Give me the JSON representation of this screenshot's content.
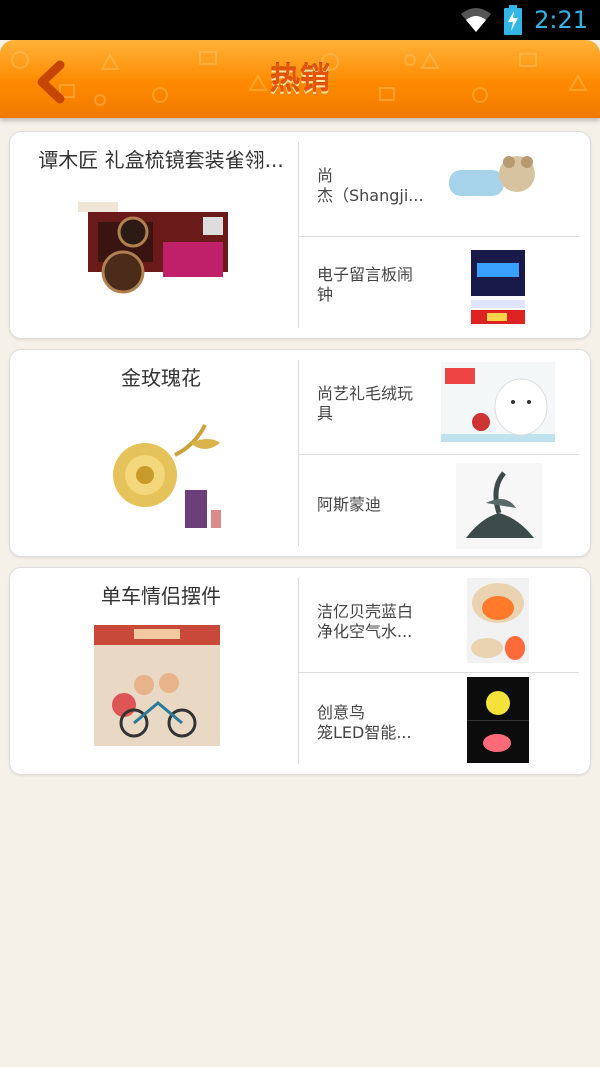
{
  "status_bar": {
    "time": "2:21",
    "wifi_icon": "wifi-icon",
    "battery_icon": "battery-charging-icon"
  },
  "header": {
    "title": "热销",
    "back_icon": "back-arrow-icon",
    "accent_color": "#ff8a00"
  },
  "cards": [
    {
      "big_item": {
        "name": "谭木匠 礼盒梳镜套装雀翎...",
        "image": "comb-mirror-gift-box-image"
      },
      "small_items": [
        {
          "name": "尚\n杰（Shangji...",
          "image": "plush-dog-pillow-image"
        },
        {
          "name": "电子留言板闹\n钟",
          "image": "led-message-board-clock-image"
        }
      ]
    },
    {
      "big_item": {
        "name": "金玫瑰花",
        "image": "gold-rose-image"
      },
      "small_items": [
        {
          "name": "尚艺礼毛绒玩\n具",
          "image": "plush-cat-toy-image"
        },
        {
          "name": "阿斯蒙迪",
          "image": "dark-figurine-image"
        }
      ]
    },
    {
      "big_item": {
        "name": "单车情侣摆件",
        "image": "bicycle-couple-ornament-image"
      },
      "small_items": [
        {
          "name": "洁亿贝壳蓝白\n净化空气水...",
          "image": "shell-lamp-image"
        },
        {
          "name": "创意鸟\n笼LED智能...",
          "image": "birdcage-led-lamp-image"
        }
      ]
    }
  ]
}
